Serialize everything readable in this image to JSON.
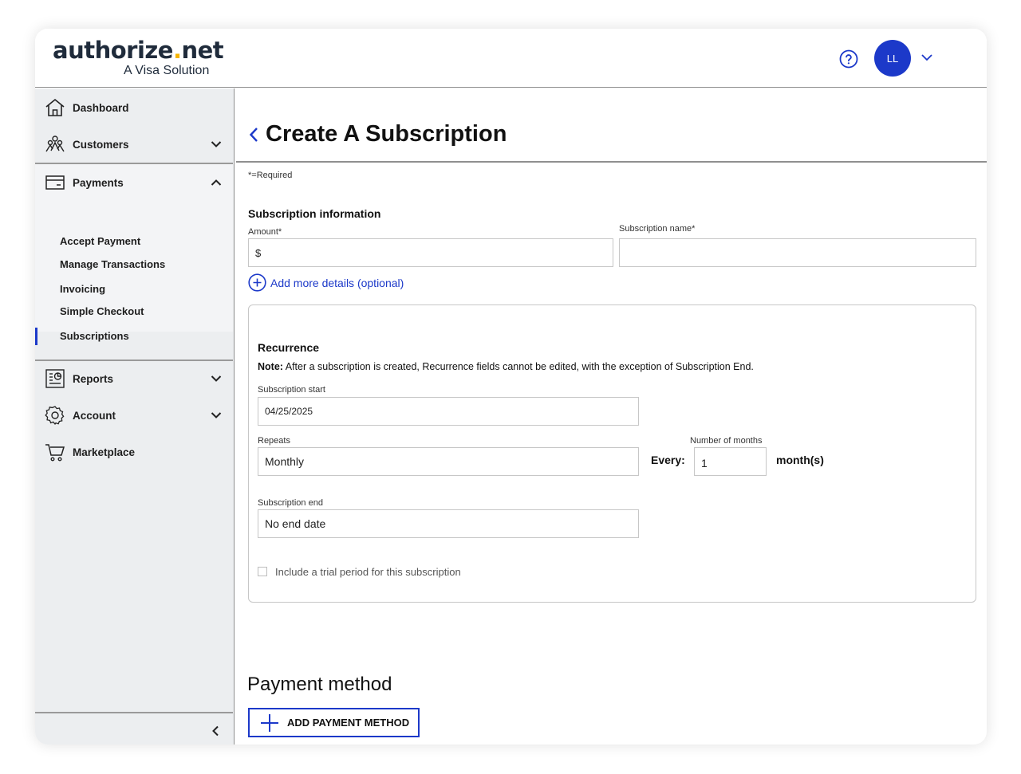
{
  "header": {
    "logo_main": "authorize",
    "logo_dot": ".",
    "logo_tld": "net",
    "logo_sub": "A Visa Solution",
    "avatar_initials": "LL"
  },
  "sidebar": {
    "dashboard": "Dashboard",
    "customers": "Customers",
    "payments": "Payments",
    "payments_items": [
      "Accept Payment",
      "Manage Transactions",
      "Invoicing",
      "Simple Checkout",
      "Subscriptions"
    ],
    "reports": "Reports",
    "account": "Account",
    "marketplace": "Marketplace",
    "active_item": "Subscriptions"
  },
  "page": {
    "title": "Create A Subscription",
    "required_note": "*=Required"
  },
  "subscription_info": {
    "section_title": "Subscription information",
    "amount_label": "Amount*",
    "amount_value": "$",
    "name_label": "Subscription name*",
    "name_value": "",
    "add_details": "Add more details (optional)"
  },
  "recurrence": {
    "title": "Recurrence",
    "note_prefix": "Note:",
    "note_text": " After a subscription is created, Recurrence fields cannot be edited, with the exception of Subscription End.",
    "start_label": "Subscription start",
    "start_value": "04/25/2025",
    "repeats_label": "Repeats",
    "repeats_value": "Monthly",
    "every_label": "Every:",
    "months_label": "Number of months",
    "months_value": "1",
    "months_suffix": "month(s)",
    "end_label": "Subscription end",
    "end_value": "No end date",
    "trial_label": "Include a trial period for this subscription",
    "trial_checked": false
  },
  "payment_method": {
    "title": "Payment method",
    "add_button": "ADD PAYMENT METHOD"
  },
  "colors": {
    "accent": "#1c39c9",
    "logo_dot": "#f5b400",
    "sidebar_bg": "#eceef0"
  },
  "icons": {
    "help": "help-circle-icon",
    "dashboard": "home-icon",
    "customers": "people-icon",
    "payments": "card-icon",
    "reports": "report-icon",
    "account": "gear-icon",
    "marketplace": "cart-icon"
  }
}
